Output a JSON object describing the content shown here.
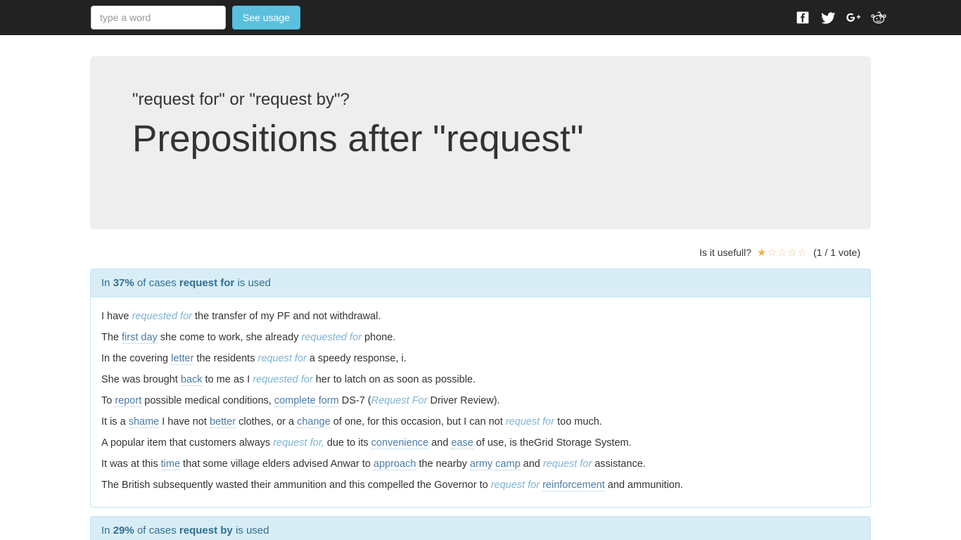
{
  "navbar": {
    "search": {
      "placeholder": "type a word",
      "value": ""
    },
    "submit_label": "See usage",
    "social": [
      {
        "name": "facebook-icon",
        "label": "Facebook"
      },
      {
        "name": "twitter-icon",
        "label": "Twitter"
      },
      {
        "name": "googleplus-icon",
        "label": "Google Plus"
      },
      {
        "name": "reddit-icon",
        "label": "Reddit"
      }
    ]
  },
  "hero": {
    "subtitle": "\"request for\" or \"request by\"?",
    "title": "Prepositions after \"request\""
  },
  "rating": {
    "question": "Is it usefull?",
    "stars_filled": 1,
    "stars_total": 5,
    "votes_text": "(1 / 1 vote)",
    "star_color": "#f0ad4e"
  },
  "sections": [
    {
      "heading_prefix": "In ",
      "percent": "37%",
      "heading_mid": " of cases ",
      "phrase": "request for",
      "heading_suffix": " is used",
      "examples": [
        "I have requested for the transfer of my PF and not withdrawal.",
        "The first day she come to work, she already requested for phone.",
        "In the covering letter the residents request for a speedy response, i.",
        "She was brought back to me as I requested for her to latch on as soon as possible.",
        "To report possible medical conditions, complete form DS-7 (Request For Driver Review).",
        "It is a shame I have not better clothes, or a change of one, for this occasion, but I can not request for too much.",
        "A popular item that customers always request for, due to its convenience and ease of use, is theGrid Storage System.",
        "It was at this time that some village elders advised Anwar to approach the nearby army camp and request for assistance.",
        "The British subsequently wasted their ammunition and this compelled the Governor to request for reinforcement and ammunition."
      ]
    },
    {
      "heading_prefix": "In ",
      "percent": "29%",
      "heading_mid": " of cases ",
      "phrase": "request by",
      "heading_suffix": " is used",
      "examples": []
    }
  ],
  "theme": {
    "navbar_bg": "#222222",
    "accent": "#5bc0de",
    "panel_header_bg": "#d9edf7",
    "panel_border": "#bce8f1",
    "panel_text": "#31708f",
    "jumbotron_bg": "#eeeeee",
    "keyword_color": "#7fb4d4"
  }
}
